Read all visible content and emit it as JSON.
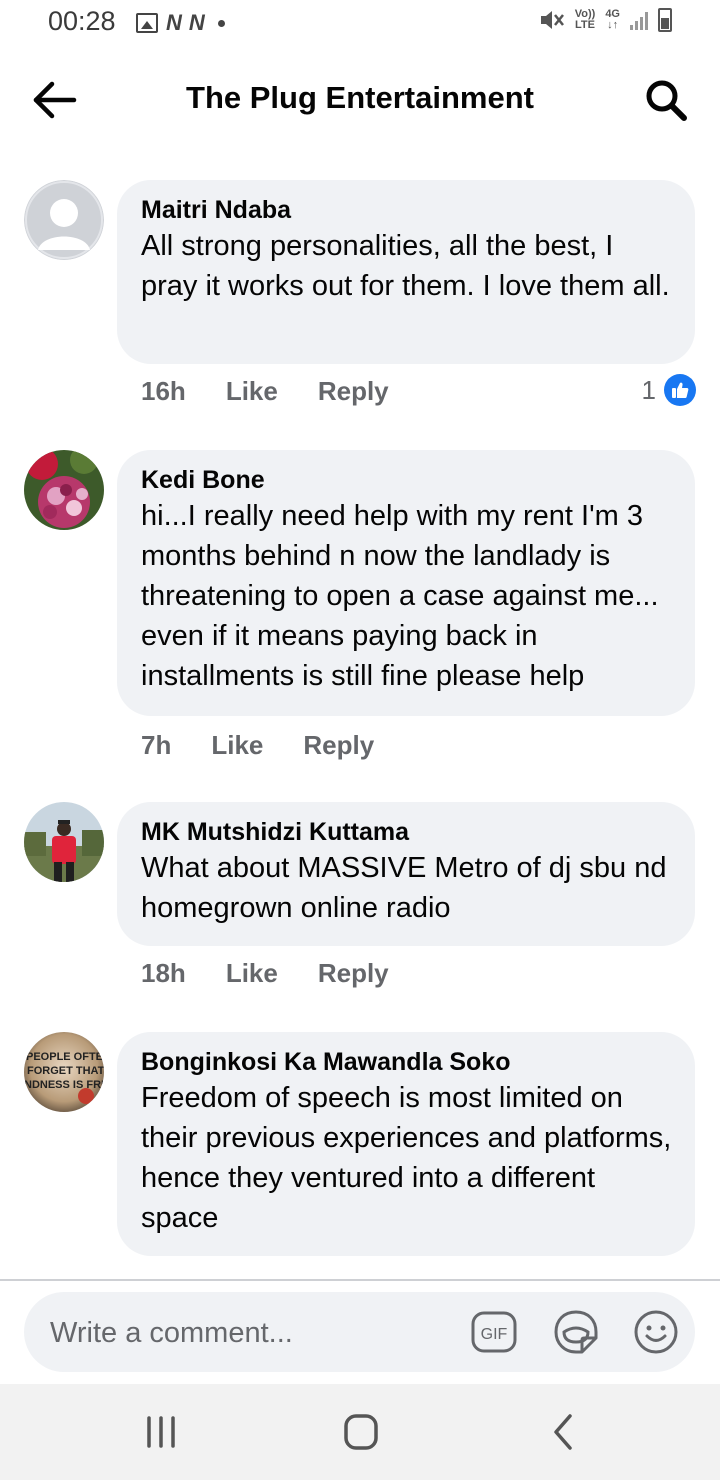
{
  "status_bar": {
    "time": "00:28",
    "network_top": "Vo))",
    "network_bottom": "LTE",
    "data_top": "4G",
    "data_bottom": "↓↑",
    "notification_letters": [
      "N",
      "N"
    ]
  },
  "header": {
    "title": "The Plug Entertainment",
    "back_icon": "arrow-left-icon",
    "search_icon": "search-icon"
  },
  "comments": [
    {
      "name": "Maitri Ndaba",
      "text": "All strong personalities, all the best, I pray it works out for them. I love them all.",
      "time": "16h",
      "like_label": "Like",
      "reply_label": "Reply",
      "reaction_count": "1",
      "avatar": "default-avatar"
    },
    {
      "name": "Kedi Bone",
      "text": "hi...I really need help with my rent I'm 3 months behind n now the landlady is threatening to open a case against me... even if it means paying back in installments is still fine please help",
      "time": "7h",
      "like_label": "Like",
      "reply_label": "Reply",
      "avatar": "flower-photo"
    },
    {
      "name": "MK Mutshidzi Kuttama",
      "text": "What about MASSIVE Metro of dj sbu nd homegrown online radio",
      "time": "18h",
      "like_label": "Like",
      "reply_label": "Reply",
      "avatar": "person-photo"
    },
    {
      "name": "Bonginkosi Ka Mawandla Soko",
      "text": "Freedom of speech is most limited on their previous experiences and platforms, hence they ventured into a different space",
      "avatar": "quote-photo",
      "avatar_text": [
        "PEOPLE OFTEN",
        "FORGET THAT",
        "NDNESS IS FRE"
      ]
    }
  ],
  "composer": {
    "placeholder": "Write a comment...",
    "icons": [
      "gif-icon",
      "sticker-icon",
      "emoji-icon"
    ]
  },
  "colors": {
    "bubble": "#f0f2f5",
    "secondary_text": "#65676b",
    "like_blue": "#1877f2",
    "primary_text": "#050505"
  }
}
